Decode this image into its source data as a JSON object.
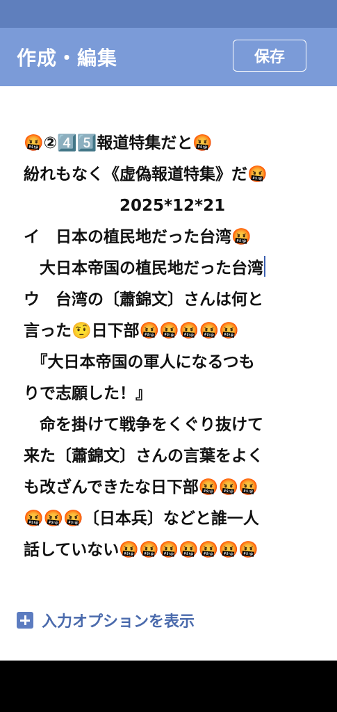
{
  "header": {
    "title": "作成・編集",
    "save_label": "保存"
  },
  "editor": {
    "lines": [
      "🤬②4️⃣5️⃣報道特集だと🤬",
      "紛れもなく《虚偽報道特集》だ🤬",
      "　　　　　　2025*12*21",
      "イ　日本の植民地だった台湾🤬",
      "　大日本帝国の植民地だった台湾",
      "ウ　台湾の〔蕭錦文〕さんは何と",
      "言った🤨日下部🤬🤬🤬🤬🤬",
      "　『大日本帝国の軍人になるつも",
      "りで志願した！』",
      "　命を掛けて戦争をくぐり抜けて",
      "来た〔蕭錦文〕さんの言葉をよく",
      "も改ざんできたな日下部🤬🤬🤬",
      "🤬🤬🤬〔日本兵〕などと誰一人",
      "話していない🤬🤬🤬🤬🤬🤬🤬"
    ]
  },
  "input_options": {
    "label": "入力オプションを表示"
  },
  "colors": {
    "status_bar": "#5f7fbd",
    "header_bg": "#7b9bd8",
    "accent": "#4a6aac"
  }
}
